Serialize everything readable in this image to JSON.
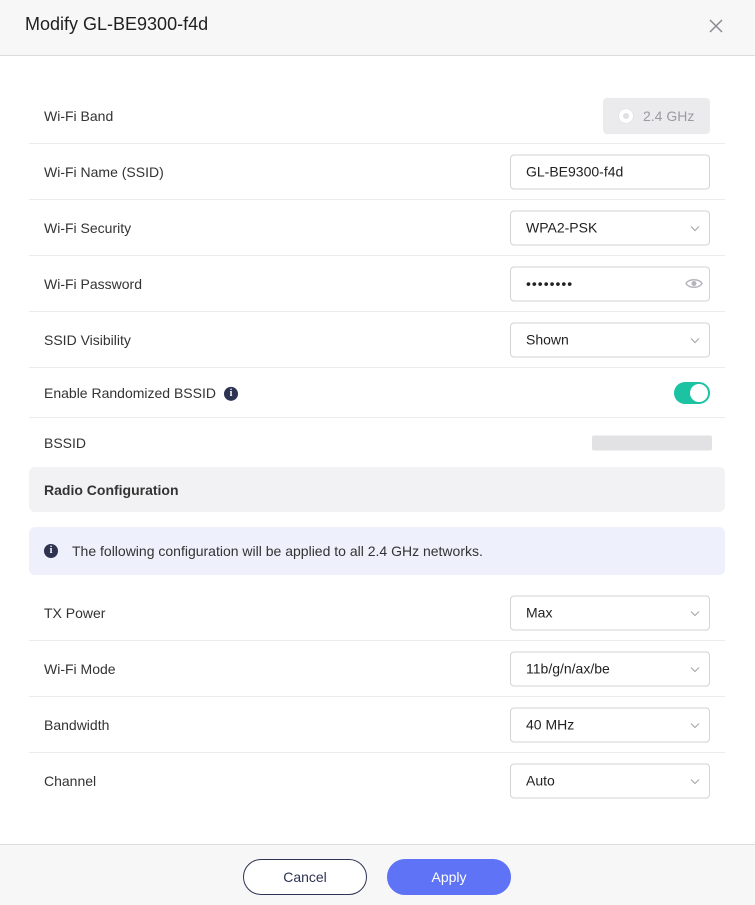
{
  "dialog": {
    "title": "Modify GL-BE9300-f4d",
    "close_icon": "close-icon"
  },
  "wifi": {
    "band_label": "Wi-Fi Band",
    "band_value": "2.4 GHz",
    "ssid_label": "Wi-Fi Name (SSID)",
    "ssid_value": "GL-BE9300-f4d",
    "security_label": "Wi-Fi Security",
    "security_value": "WPA2-PSK",
    "password_label": "Wi-Fi Password",
    "password_value": "••••••••",
    "visibility_label": "SSID Visibility",
    "visibility_value": "Shown",
    "randomized_label": "Enable Randomized BSSID",
    "randomized_enabled": true,
    "bssid_label": "BSSID"
  },
  "radio": {
    "section_title": "Radio Configuration",
    "notice": "The following configuration will be applied to all 2.4 GHz networks.",
    "tx_power_label": "TX Power",
    "tx_power_value": "Max",
    "mode_label": "Wi-Fi Mode",
    "mode_value": "11b/g/n/ax/be",
    "bandwidth_label": "Bandwidth",
    "bandwidth_value": "40 MHz",
    "channel_label": "Channel",
    "channel_value": "Auto"
  },
  "footer": {
    "cancel_label": "Cancel",
    "apply_label": "Apply"
  },
  "colors": {
    "accent": "#5e73f5",
    "toggle_on": "#1bc3a3",
    "info_icon": "#2e3352"
  }
}
